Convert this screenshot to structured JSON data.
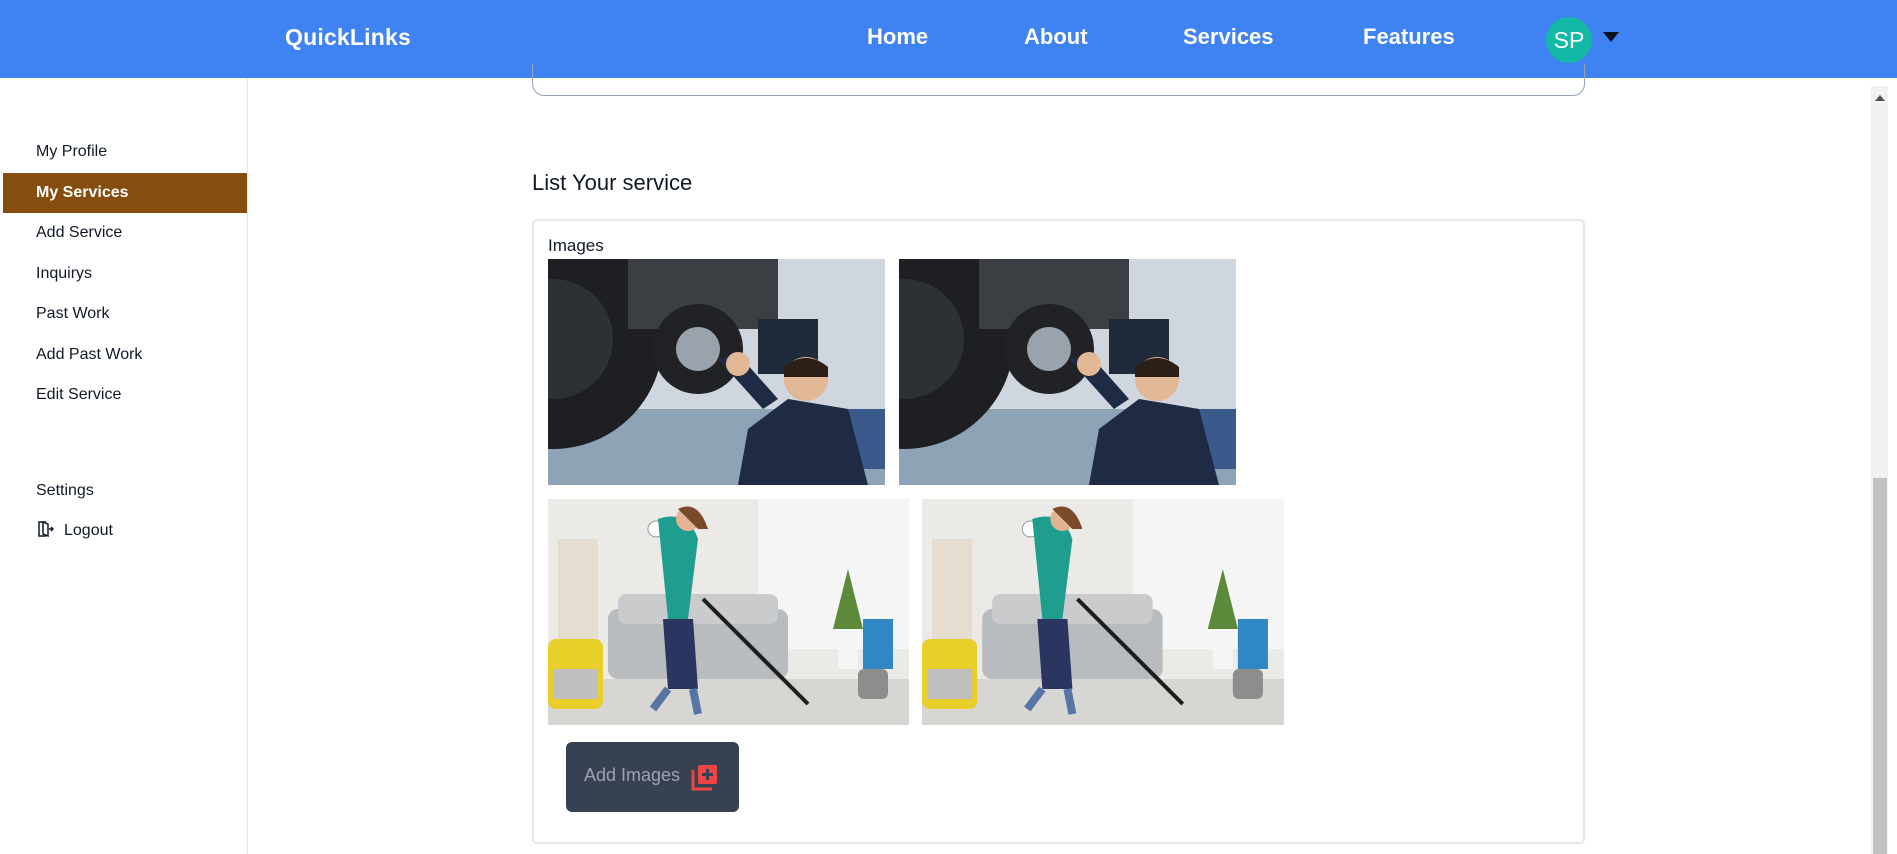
{
  "header": {
    "brand": "QuickLinks",
    "nav": {
      "home": "Home",
      "about": "About",
      "services": "Services",
      "features": "Features"
    },
    "avatar_initials": "SP"
  },
  "sidebar": {
    "items": [
      {
        "label": "My Profile"
      },
      {
        "label": "My Services"
      },
      {
        "label": "Add Service"
      },
      {
        "label": "Inquirys"
      },
      {
        "label": "Past Work"
      },
      {
        "label": "Add Past Work"
      },
      {
        "label": "Edit Service"
      },
      {
        "label": "Settings"
      },
      {
        "label": "Logout",
        "icon": "logout-icon"
      }
    ],
    "active": "My Services"
  },
  "main": {
    "section_title": "List Your service",
    "images_label": "Images",
    "images": [
      {
        "subject": "mechanic under car"
      },
      {
        "subject": "mechanic under car"
      },
      {
        "subject": "woman vacuuming living room"
      },
      {
        "subject": "woman vacuuming living room"
      }
    ],
    "add_images_label": "Add Images",
    "add_images_icon": "add-image-icon"
  },
  "colors": {
    "topbar": "#3f82f2",
    "sidebar_active": "#854d0e",
    "avatar": "#14b8a6",
    "button_bg": "#374151",
    "button_icon": "#ef4444"
  }
}
